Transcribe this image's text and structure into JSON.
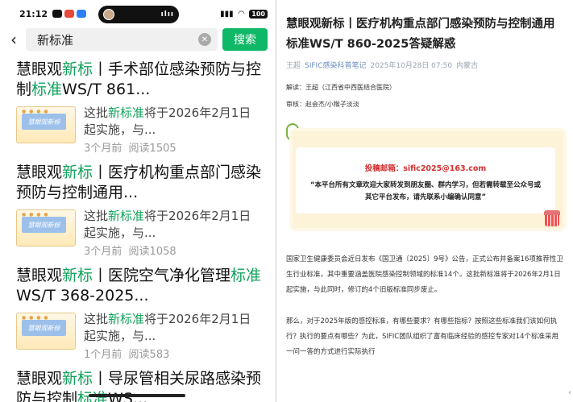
{
  "status": {
    "time": "21:12",
    "battery": "100"
  },
  "search": {
    "query": "新标准",
    "button": "搜索"
  },
  "results": [
    {
      "pre": "慧眼观",
      "hl1": "新标",
      "mid": "丨手术部位感染预防与控制",
      "hl2": "标准",
      "post": "WS/T 861...",
      "snip_pre": "这批",
      "snip_hl": "新标准",
      "snip_post": "将于2026年2月1日起实施，与...",
      "time": "3个月前",
      "reads": "阅读1505"
    },
    {
      "pre": "慧眼观",
      "hl1": "新标",
      "mid": "丨医疗机构重点部门感染预防与控制通用...",
      "hl2": "",
      "post": "",
      "snip_pre": "这批",
      "snip_hl": "新标准",
      "snip_post": "将于2026年2月1日起实施，与...",
      "time": "3个月前",
      "reads": "阅读1058"
    },
    {
      "pre": "慧眼观",
      "hl1": "新标",
      "mid": "丨医院空气净化管理",
      "hl2": "标准",
      "post": "WS/T 368-2025...",
      "snip_pre": "这批",
      "snip_hl": "新标准",
      "snip_post": "将于2026年2月1日起实施，与...",
      "time": "1个月前",
      "reads": "阅读583"
    },
    {
      "pre": "慧眼观",
      "hl1": "新标",
      "mid": "丨导尿管相关尿路感染预防与控制",
      "hl2": "标准",
      "post": "WS...",
      "snip_pre": "",
      "snip_hl": "",
      "snip_post": "",
      "time": "",
      "reads": ""
    }
  ],
  "thumb_text": "慧眼观新标",
  "article": {
    "title": "慧眼观新标丨医疗机构重点部门感染预防与控制通用标准WS/T 860-2025答疑解惑",
    "author": "王超",
    "publisher": "SIFIC感染科普笔记",
    "date": "2025年10月28日 07:50",
    "location": "内蒙古",
    "interpreter": "解读：王超（江西省中西医结合医院）",
    "reviewer": "审核：赵会杰/小猴子淡淡",
    "card_email": "投稿邮箱：sific2025@163.com",
    "card_note": "“本平台所有文章欢迎大家转发到朋友圈、群内学习，但若需转载至公众号或其它平台发布，请先联系小编确认同意”",
    "para1": "国家卫生健康委员会近日发布《国卫通〔2025〕9号》公告，正式公布并备案16项推荐性卫生行业标准，其中重要涵盖医院感染控制领域的标准14个。这批新标准将于2026年2月1日起实施，与此同时，修订的4个旧版标准同步废止。",
    "para2": "那么，对于2025年版的感控标准，有哪些要求？有哪些指标？按照这些标准我们该如何执行？执行的要点有哪些？为此，SIFIC团队组织了富有临床经验的感控专家对14个标准采用一问一答的方式进行实际执行"
  }
}
